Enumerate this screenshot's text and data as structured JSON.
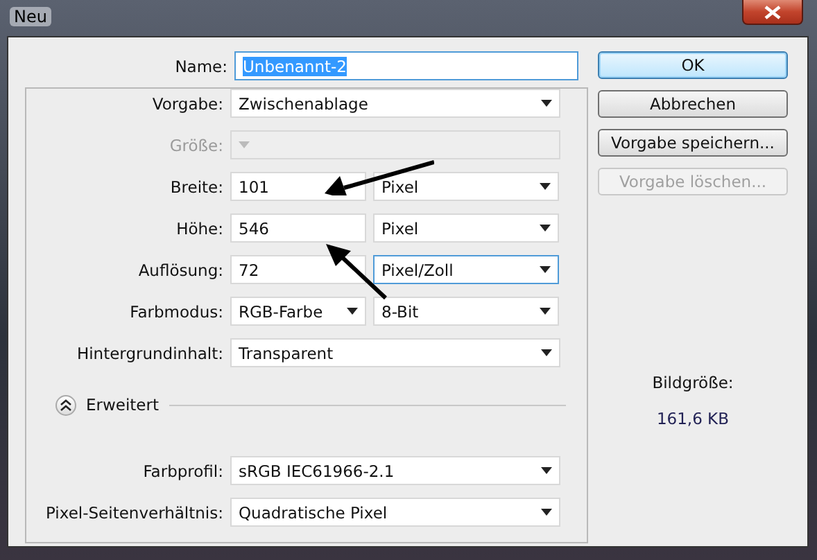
{
  "window": {
    "title": "Neu"
  },
  "name": {
    "label": "Name:",
    "value": "Unbenannt-2",
    "text_highlighted": true
  },
  "preset_fields": [
    {
      "kind": "select",
      "label": "Vorgabe:",
      "value": "Zwischenablage",
      "disabled": false
    },
    {
      "kind": "select",
      "label": "Größe:",
      "disabled": true
    },
    {
      "kind": "number_unit",
      "label": "Breite:",
      "value": "101",
      "unit": "Pixel",
      "focused": false
    },
    {
      "kind": "number_unit",
      "label": "Höhe:",
      "value": "546",
      "unit": "Pixel",
      "focused": false
    },
    {
      "kind": "number_unit",
      "label": "Auflösung:",
      "value": "72",
      "unit": "Pixel/Zoll",
      "focused": true
    },
    {
      "kind": "dual_select",
      "label": "Farbmodus:",
      "value": "RGB-Farbe",
      "value2": "8-Bit"
    },
    {
      "kind": "select",
      "label": "Hintergrundinhalt:",
      "value": "Transparent",
      "disabled": false
    }
  ],
  "advanced": {
    "label": "Erweitert",
    "expanded": true,
    "fields": [
      {
        "kind": "select",
        "label": "Farbprofil:",
        "value": "sRGB IEC61966-2.1",
        "disabled": false
      },
      {
        "kind": "select",
        "label": "Pixel-Seitenverhältnis:",
        "value": "Quadratische Pixel",
        "disabled": false
      }
    ]
  },
  "buttons": [
    {
      "label": "OK",
      "default": true,
      "disabled": false
    },
    {
      "label": "Abbrechen",
      "default": false,
      "disabled": false
    },
    {
      "label": "Vorgabe speichern...",
      "default": false,
      "disabled": false
    },
    {
      "label": "Vorgabe löschen...",
      "default": false,
      "disabled": true
    }
  ],
  "image_size": {
    "label": "Bildgröße:",
    "value": "161,6 KB"
  }
}
